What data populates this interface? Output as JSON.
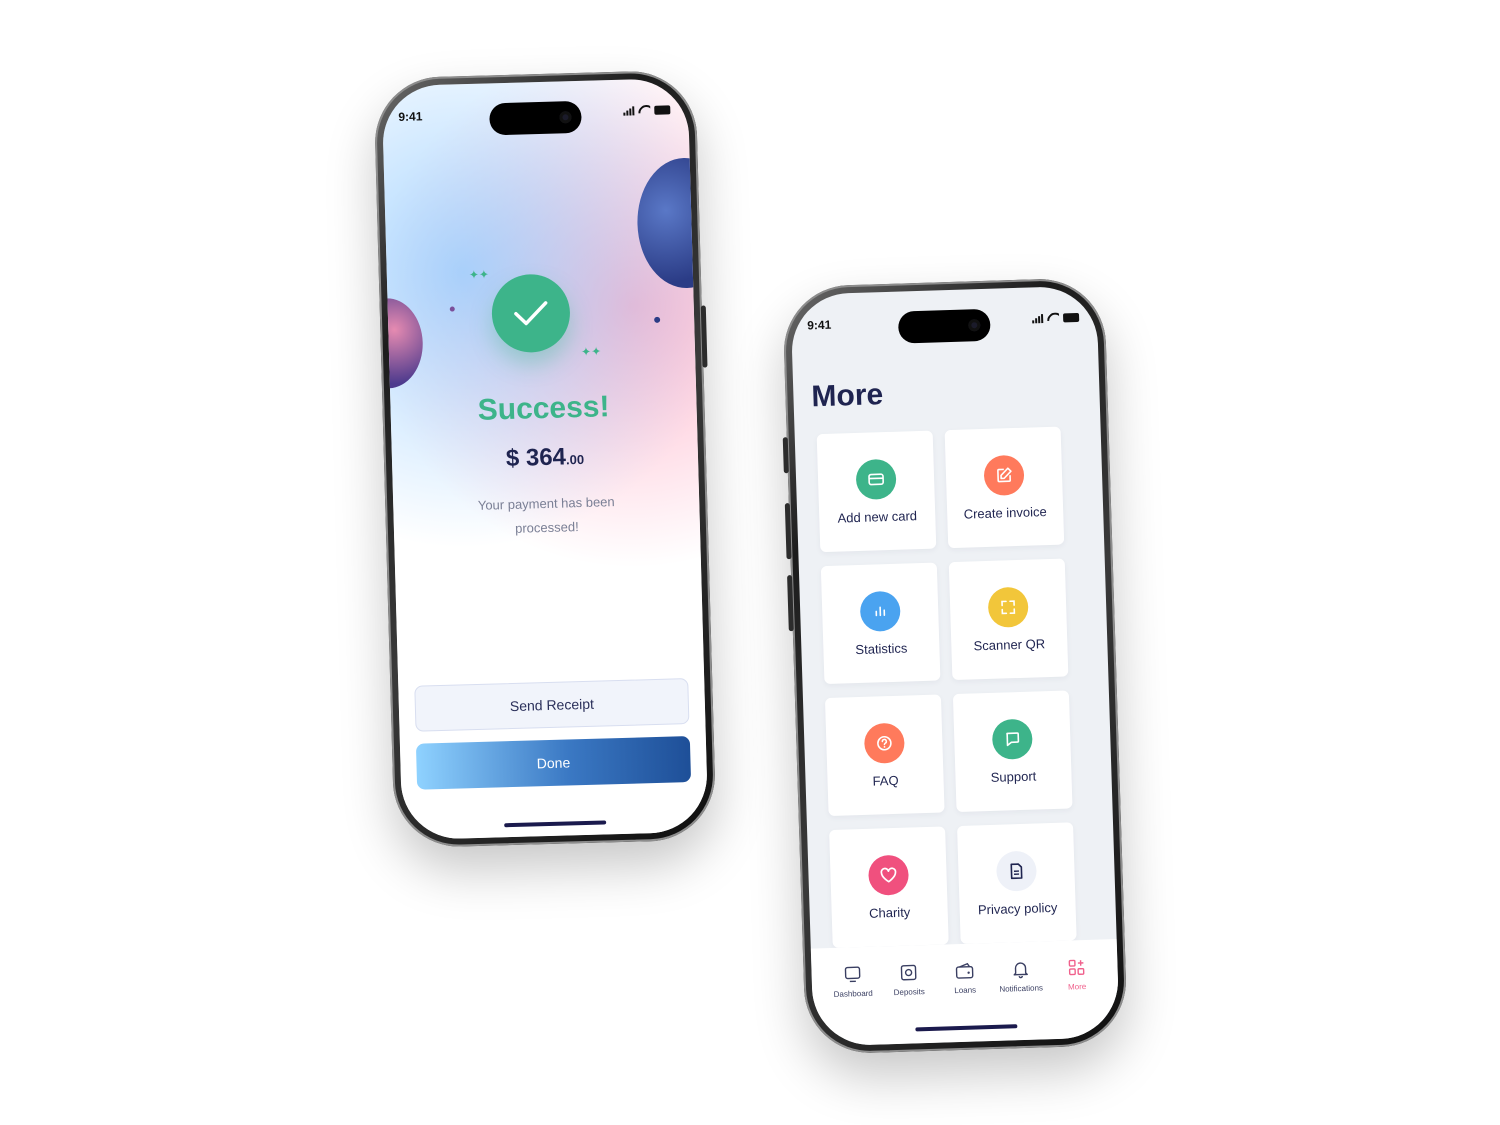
{
  "status_bar": {
    "time": "9:41"
  },
  "success_screen": {
    "title": "Success!",
    "amount_main": "$ 364",
    "amount_cents": ".00",
    "message": "Your payment has been processed!",
    "send_receipt_label": "Send Receipt",
    "done_label": "Done",
    "accent_color": "#3db48a"
  },
  "more_screen": {
    "title": "More",
    "tiles": [
      {
        "label": "Add new card",
        "icon": "card-icon",
        "color": "#3db48a"
      },
      {
        "label": "Create invoice",
        "icon": "edit-icon",
        "color": "#ff7a5c"
      },
      {
        "label": "Statistics",
        "icon": "chart-icon",
        "color": "#4aa3f0"
      },
      {
        "label": "Scanner QR",
        "icon": "scan-icon",
        "color": "#f2c63a"
      },
      {
        "label": "FAQ",
        "icon": "question-icon",
        "color": "#ff7a5c"
      },
      {
        "label": "Support",
        "icon": "chat-icon",
        "color": "#3db48a"
      },
      {
        "label": "Charity",
        "icon": "heart-icon",
        "color": "#f0507e"
      },
      {
        "label": "Privacy policy",
        "icon": "document-icon",
        "color": "#eef1f8"
      }
    ],
    "tabs": [
      {
        "label": "Dashboard",
        "icon": "dashboard-icon"
      },
      {
        "label": "Deposits",
        "icon": "safe-icon"
      },
      {
        "label": "Loans",
        "icon": "wallet-icon"
      },
      {
        "label": "Notifications",
        "icon": "bell-icon"
      },
      {
        "label": "More",
        "icon": "grid-plus-icon",
        "active": true
      }
    ],
    "active_tab_color": "#f0608c"
  }
}
